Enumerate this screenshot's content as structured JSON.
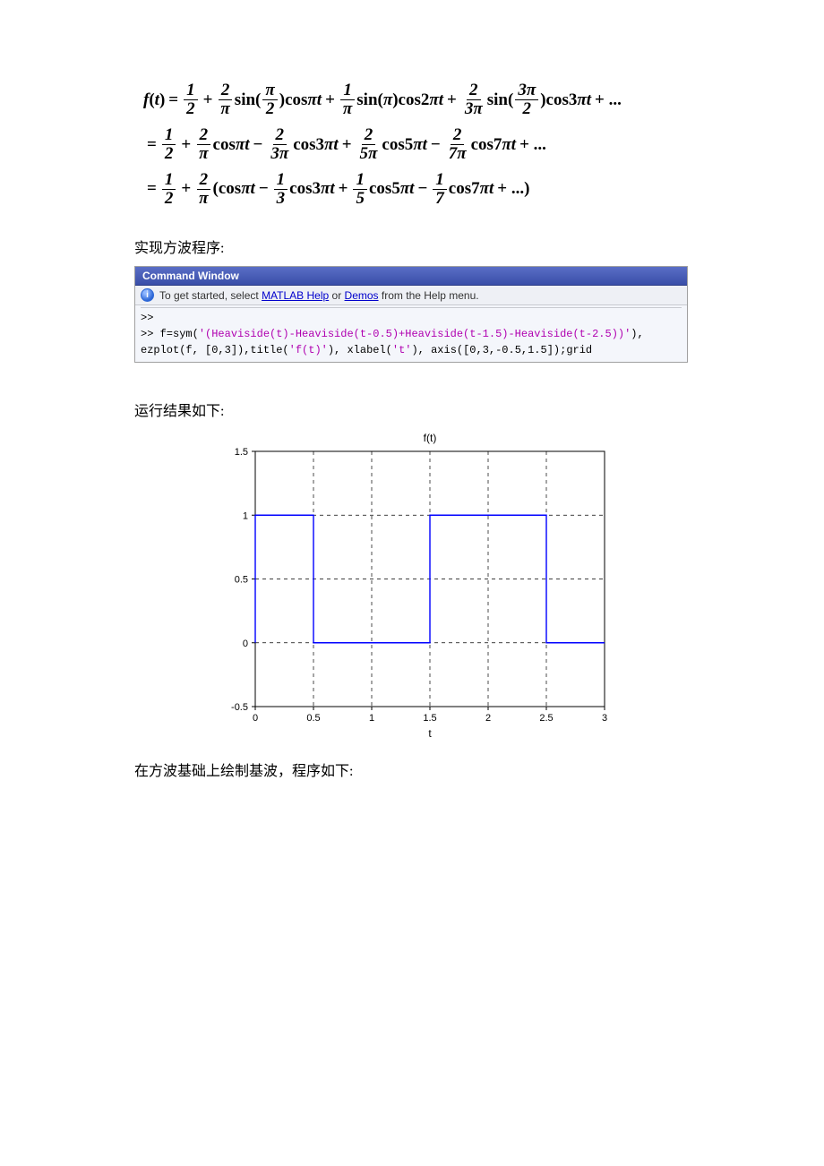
{
  "formula": {
    "line1_prefix": "f(t) = ",
    "line1_terms": [
      "1",
      "2",
      "2",
      "π",
      "π",
      "2",
      "1",
      "π",
      "2",
      "3π",
      "3π",
      "2"
    ],
    "text1": "f(t) = ½ + (2/π) sin(π/2) cos πt + (1/π) sin(π) cos 2πt + (2/3π) sin(3π/2) cos 3πt + ...",
    "text2": "= ½ + (2/π) cos πt − (2/3π) cos 3πt + (2/5π) cos 5πt − (2/7π) cos 7πt + ...",
    "text3": "= ½ + (2/π)(cos πt − ⅓ cos 3πt + ⅕ cos 5πt − (1/7) cos 7πt + ...)"
  },
  "caption_program": "实现方波程序:",
  "cmd": {
    "title": "Command Window",
    "hint_pre": "To get started, select ",
    "hint_help": "MATLAB Help",
    "hint_mid": " or ",
    "hint_demos": "Demos",
    "hint_post": " from the Help menu.",
    "prompt1": ">>",
    "line2a": ">> f=sym(",
    "line2b": "'(Heaviside(t)-Heaviside(t-0.5)+Heaviside(t-1.5)-Heaviside(t-2.5))'",
    "line2c": "),",
    "line3a": "ezplot(f, [0,3]),title(",
    "line3b": "'f(t)'",
    "line3c": "), xlabel(",
    "line3d": "'t'",
    "line3e": "), axis([0,3,-0.5,1.5]);grid"
  },
  "caption_result": "运行结果如下:",
  "chart_data": {
    "type": "line",
    "title": "f(t)",
    "xlabel": "t",
    "ylabel": "",
    "xlim": [
      0,
      3
    ],
    "ylim": [
      -0.5,
      1.5
    ],
    "xticks": [
      0,
      0.5,
      1,
      1.5,
      2,
      2.5,
      3
    ],
    "yticks": [
      -0.5,
      0,
      0.5,
      1,
      1.5
    ],
    "grid": true,
    "series": [
      {
        "name": "f(t)",
        "color": "#0000ff",
        "x": [
          0,
          0,
          0.5,
          0.5,
          1.5,
          1.5,
          2.5,
          2.5,
          3
        ],
        "y": [
          0,
          1,
          1,
          0,
          0,
          1,
          1,
          0,
          0
        ]
      }
    ]
  },
  "caption_next": "在方波基础上绘制基波，程序如下:"
}
